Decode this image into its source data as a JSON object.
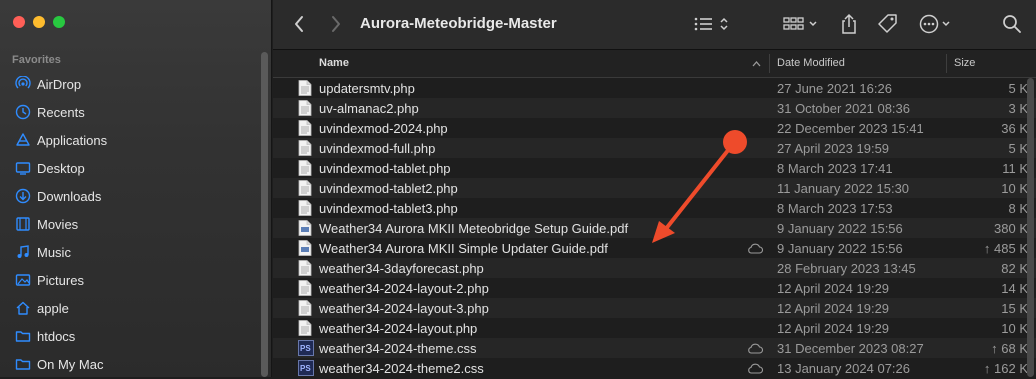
{
  "window": {
    "title": "Aurora-Meteobridge-Master"
  },
  "sidebar": {
    "section": "Favorites",
    "items": [
      {
        "label": "AirDrop",
        "icon": "airdrop-icon"
      },
      {
        "label": "Recents",
        "icon": "clock-icon"
      },
      {
        "label": "Applications",
        "icon": "applications-icon"
      },
      {
        "label": "Desktop",
        "icon": "desktop-icon"
      },
      {
        "label": "Downloads",
        "icon": "downloads-icon"
      },
      {
        "label": "Movies",
        "icon": "film-icon"
      },
      {
        "label": "Music",
        "icon": "music-note-icon"
      },
      {
        "label": "Pictures",
        "icon": "photo-icon"
      },
      {
        "label": "apple",
        "icon": "home-icon"
      },
      {
        "label": "htdocs",
        "icon": "folder-icon"
      },
      {
        "label": "On My Mac",
        "icon": "folder-icon"
      }
    ]
  },
  "columns": {
    "name": "Name",
    "date": "Date Modified",
    "size": "Size"
  },
  "files": [
    {
      "name": "updatersmtv.php",
      "date": "27 June 2021 16:26",
      "size": "5 K",
      "type": "php"
    },
    {
      "name": "uv-almanac2.php",
      "date": "31 October 2021 08:36",
      "size": "3 K",
      "type": "php"
    },
    {
      "name": "uvindexmod-2024.php",
      "date": "22 December 2023 15:41",
      "size": "36 K",
      "type": "php"
    },
    {
      "name": "uvindexmod-full.php",
      "date": "27 April 2023 19:59",
      "size": "5 K",
      "type": "php"
    },
    {
      "name": "uvindexmod-tablet.php",
      "date": "8 March 2023 17:41",
      "size": "11 K",
      "type": "php"
    },
    {
      "name": "uvindexmod-tablet2.php",
      "date": "11 January 2022 15:30",
      "size": "10 K",
      "type": "php"
    },
    {
      "name": "uvindexmod-tablet3.php",
      "date": "8 March 2023 17:53",
      "size": "8 K",
      "type": "php"
    },
    {
      "name": "Weather34 Aurora MKII Meteobridge Setup Guide.pdf",
      "date": "9 January 2022 15:56",
      "size": "380 K",
      "type": "pdf"
    },
    {
      "name": "Weather34 Aurora MKII Simple Updater Guide.pdf",
      "date": "9 January 2022 15:56",
      "size": "↑ 485 K",
      "type": "pdf",
      "cloud": true
    },
    {
      "name": "weather34-3dayforecast.php",
      "date": "28 February 2023 13:45",
      "size": "82 K",
      "type": "php"
    },
    {
      "name": "weather34-2024-layout-2.php",
      "date": "12 April 2024 19:29",
      "size": "14 K",
      "type": "php"
    },
    {
      "name": "weather34-2024-layout-3.php",
      "date": "12 April 2024 19:29",
      "size": "15 K",
      "type": "php"
    },
    {
      "name": "weather34-2024-layout.php",
      "date": "12 April 2024 19:29",
      "size": "10 K",
      "type": "php"
    },
    {
      "name": "weather34-2024-theme.css",
      "date": "31 December 2023 08:27",
      "size": "↑ 68 K",
      "type": "css",
      "cloud": true
    },
    {
      "name": "weather34-2024-theme2.css",
      "date": "13 January 2024 07:26",
      "size": "↑ 162 K",
      "type": "css",
      "cloud": true
    }
  ],
  "colors": {
    "accent": "#2f8cff",
    "annotation": "#ee4b2b"
  }
}
